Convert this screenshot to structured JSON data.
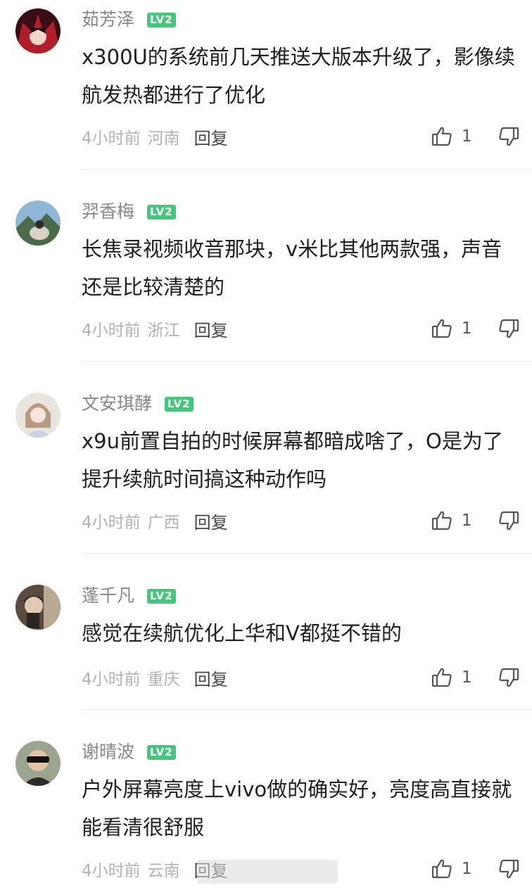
{
  "comments": [
    {
      "username": "茹芳泽",
      "level": "LV2",
      "text": "x300U的系统前几天推送大版本升级了，影像续航发热都进行了优化",
      "time": "4小时前",
      "location": "河南",
      "reply_label": "回复",
      "likes": "1"
    },
    {
      "username": "羿香梅",
      "level": "LV2",
      "text": "长焦录视频收音那块，v米比其他两款强，声音还是比较清楚的",
      "time": "4小时前",
      "location": "浙江",
      "reply_label": "回复",
      "likes": "1"
    },
    {
      "username": "文安琪酵",
      "level": "LV2",
      "text": "x9u前置自拍的时候屏幕都暗成啥了，O是为了提升续航时间搞这种动作吗",
      "time": "4小时前",
      "location": "广西",
      "reply_label": "回复",
      "likes": "1"
    },
    {
      "username": "蓬千凡",
      "level": "LV2",
      "text": "感觉在续航优化上华和V都挺不错的",
      "time": "4小时前",
      "location": "重庆",
      "reply_label": "回复",
      "likes": "1"
    },
    {
      "username": "谢晴波",
      "level": "LV2",
      "text": "户外屏幕亮度上vivo做的确实好，亮度高直接就能看清很舒服",
      "time": "4小时前",
      "location": "云南",
      "reply_label": "回复",
      "likes": "1"
    }
  ],
  "icons": {
    "like": "thumbs-up-icon",
    "dislike": "thumbs-down-icon"
  },
  "colors": {
    "level_badge": "#44c77a",
    "username": "#888888",
    "meta": "#b3b3b3"
  }
}
